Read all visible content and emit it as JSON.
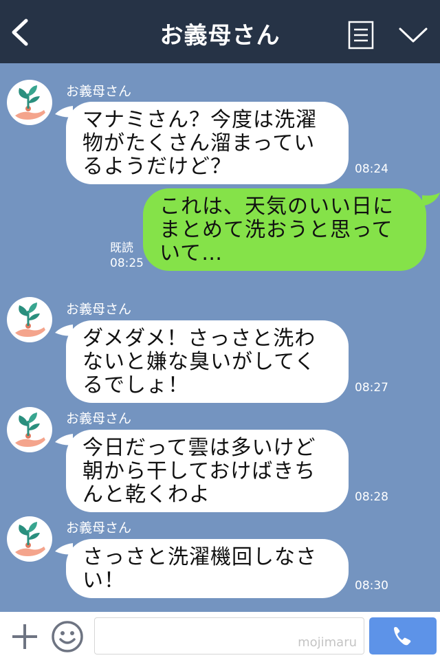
{
  "header": {
    "title": "お義母さん"
  },
  "messages": [
    {
      "sender": "お義母さん",
      "text": "マナミさん？今度は洗濯物がたくさん溜まっているようだけど？",
      "time": "08:24"
    },
    {
      "text": "これは、天気のいい日にまとめて洗おうと思っていて…",
      "read_label": "既読",
      "time": "08:25"
    },
    {
      "sender": "お義母さん",
      "text": "ダメダメ！さっさと洗わないと嫌な臭いがしてくるでしょ！",
      "time": "08:27"
    },
    {
      "sender": "お義母さん",
      "text": "今日だって雲は多いけど朝から干しておけばきちんと乾くわよ",
      "time": "08:28"
    },
    {
      "sender": "お義母さん",
      "text": "さっさと洗濯機回しなさい！",
      "time": "08:30"
    }
  ],
  "footer": {
    "watermark": "mojimaru"
  },
  "icons": {
    "back": "chevron-left-icon",
    "menu": "menu-icon",
    "expand": "chevron-down-icon",
    "add": "plus-icon",
    "emoji": "smile-icon",
    "call": "phone-icon",
    "avatar": "plant-in-hand-icon"
  },
  "colors": {
    "header_bg": "#263346",
    "chat_bg": "#7494c0",
    "incoming_bubble": "#ffffff",
    "outgoing_bubble": "#85e249",
    "send_button": "#5d93e8"
  }
}
